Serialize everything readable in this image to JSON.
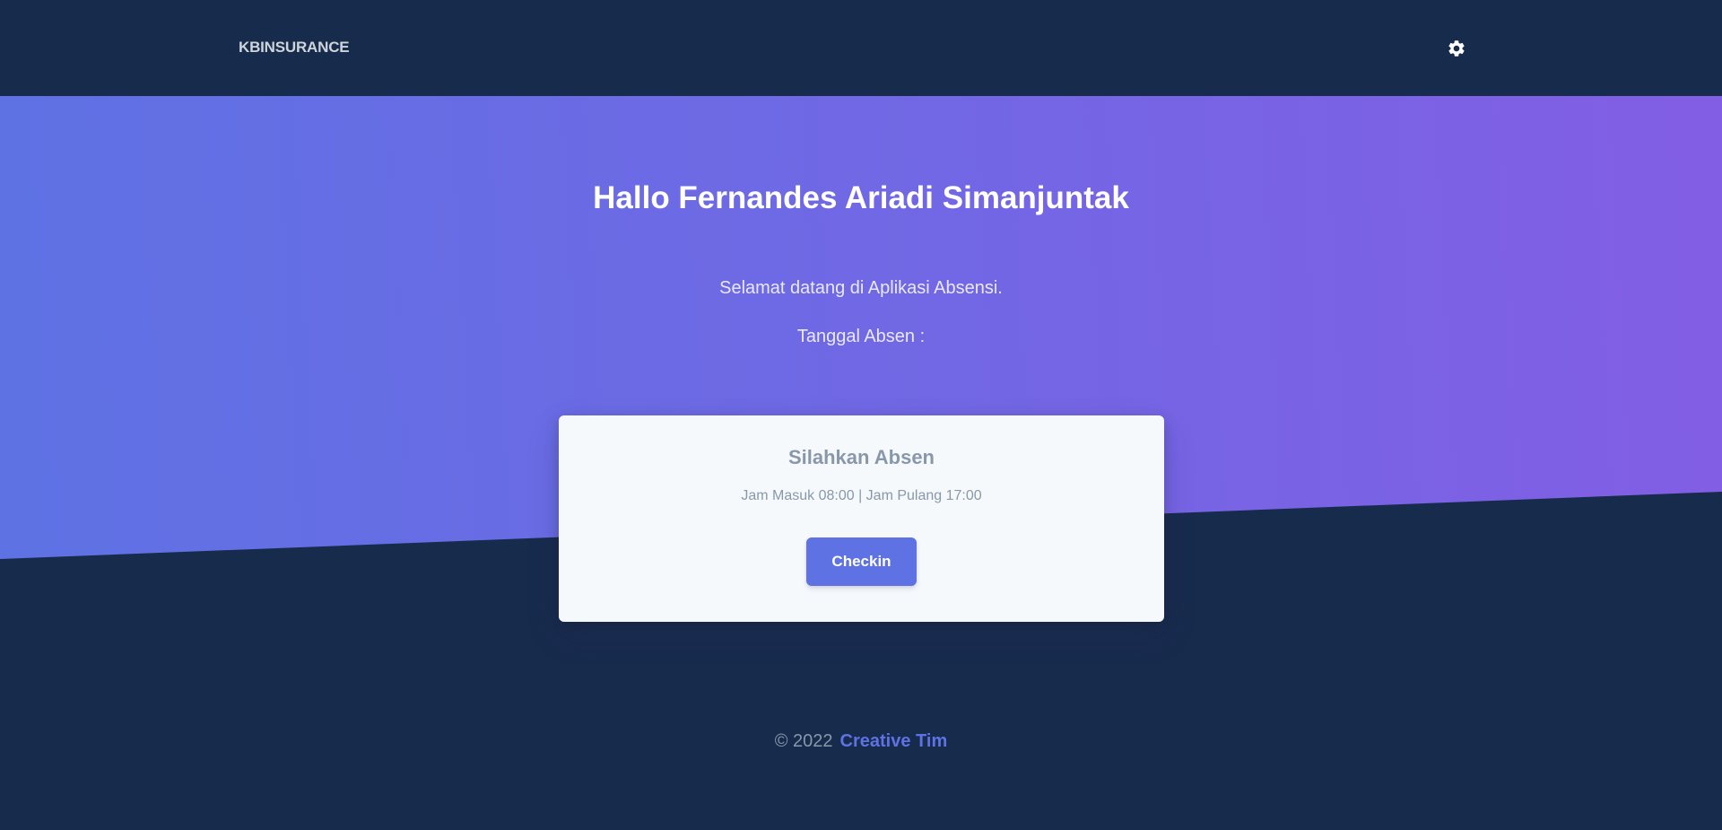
{
  "navbar": {
    "brand": "KBINSURANCE",
    "settings_icon": "gear-icon"
  },
  "hero": {
    "title": "Hallo Fernandes Ariadi Simanjuntak",
    "subtitle": "Selamat datang di Aplikasi Absensi.",
    "date_label": "Tanggal Absen :"
  },
  "card": {
    "title": "Silahkan Absen",
    "schedule": "Jam Masuk 08:00 | Jam Pulang 17:00",
    "button_label": "Checkin"
  },
  "footer": {
    "copyright": "© 2022",
    "link_text": "Creative Tim"
  },
  "colors": {
    "background": "#172b4d",
    "gradient_start": "#5e72e4",
    "gradient_end": "#825ee4",
    "primary": "#5e72e4",
    "card_bg": "#f6f9fc",
    "muted_text": "#8898aa"
  }
}
